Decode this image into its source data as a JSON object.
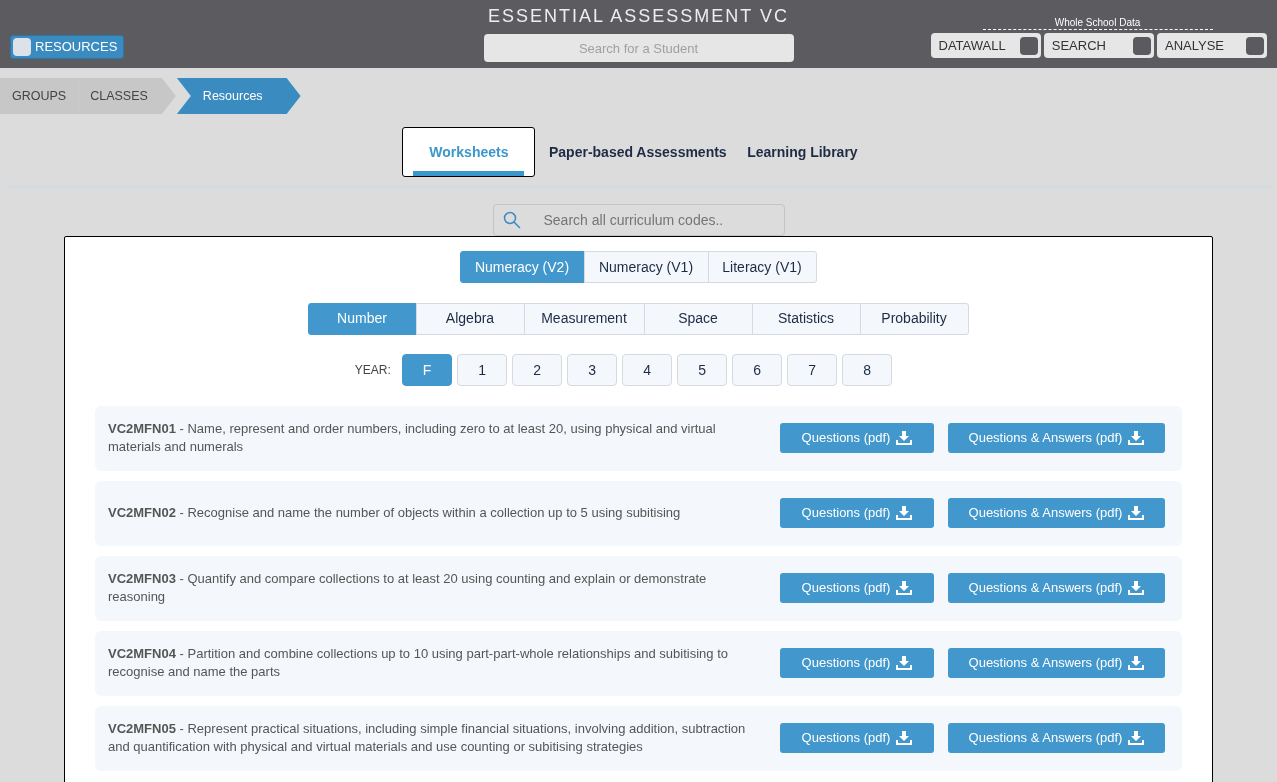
{
  "header": {
    "title": "ESSENTIAL ASSESSMENT VC",
    "resources_toggle": {
      "label": "RESOURCES",
      "on": true
    },
    "student_search": {
      "placeholder": "Search for a Student"
    },
    "whole_school_label": "Whole School Data",
    "toggles": [
      {
        "label": "DATAWALL",
        "on": false
      },
      {
        "label": "SEARCH",
        "on": false
      },
      {
        "label": "ANALYSE",
        "on": false
      }
    ]
  },
  "breadcrumb": [
    {
      "label": "GROUPS",
      "selected": false
    },
    {
      "label": "CLASSES",
      "selected": false
    },
    {
      "label": "Resources",
      "selected": true
    }
  ],
  "tabs": [
    {
      "label": "Worksheets",
      "selected": true
    },
    {
      "label": "Paper-based Assessments",
      "selected": false
    },
    {
      "label": "Learning Library",
      "selected": false
    }
  ],
  "curriculum_search": {
    "placeholder": "Search all curriculum codes.."
  },
  "subjects": [
    {
      "label": "Numeracy (V2)",
      "selected": true
    },
    {
      "label": "Numeracy (V1)",
      "selected": false
    },
    {
      "label": "Literacy (V1)",
      "selected": false
    }
  ],
  "strands": [
    {
      "label": "Number",
      "selected": true
    },
    {
      "label": "Algebra",
      "selected": false
    },
    {
      "label": "Measurement",
      "selected": false
    },
    {
      "label": "Space",
      "selected": false
    },
    {
      "label": "Statistics",
      "selected": false
    },
    {
      "label": "Probability",
      "selected": false
    }
  ],
  "year_label": "YEAR:",
  "years": [
    {
      "label": "F",
      "selected": true
    },
    {
      "label": "1",
      "selected": false
    },
    {
      "label": "2",
      "selected": false
    },
    {
      "label": "3",
      "selected": false
    },
    {
      "label": "4",
      "selected": false
    },
    {
      "label": "5",
      "selected": false
    },
    {
      "label": "6",
      "selected": false
    },
    {
      "label": "7",
      "selected": false
    },
    {
      "label": "8",
      "selected": false
    }
  ],
  "worksheets": [
    {
      "description": "**VC2MFN01** - Name, represent and order numbers, including zero to at least 20, using physical and virtual materials and numerals",
      "buttons": [
        "Questions (pdf)",
        "Questions & Answers (pdf)"
      ]
    },
    {
      "description": "**VC2MFN02** - Recognise and name the number of objects within a collection up to 5 using subitising",
      "buttons": [
        "Questions (pdf)",
        "Questions & Answers (pdf)"
      ]
    },
    {
      "description": "**VC2MFN03** - Quantify and compare collections to at least 20 using counting and explain or demonstrate reasoning",
      "buttons": [
        "Questions (pdf)",
        "Questions & Answers (pdf)"
      ]
    },
    {
      "description": "**VC2MFN04** - Partition and combine collections up to 10 using part-part-whole relationships and subitising to recognise and name the parts",
      "buttons": [
        "Questions (pdf)",
        "Questions & Answers (pdf)"
      ]
    },
    {
      "description": "**VC2MFN05** - Represent practical situations, including simple financial situations, involving addition, subtraction and quantification with physical and virtual materials and use counting or subitising strategies",
      "buttons": [
        "Questions (pdf)",
        "Questions & Answers (pdf)"
      ]
    }
  ]
}
